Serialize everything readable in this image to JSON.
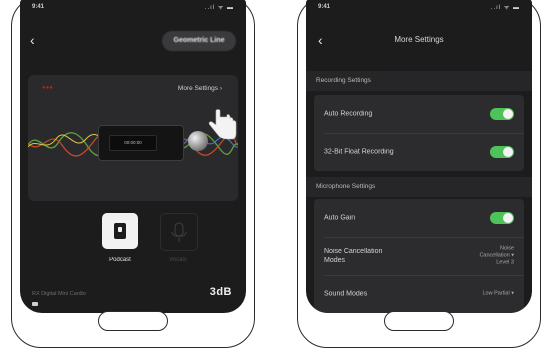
{
  "left_screen": {
    "status": {
      "time": "9:41",
      "icons": "..ıl ᯤ ▬"
    },
    "header": {
      "back_icon": "chevron-left-icon",
      "geometric_button_label": "Geometric Line"
    },
    "card": {
      "more_settings_label": "More Settings  ›",
      "device_screen_text": "00:00:00",
      "wave_colors": [
        "#5c9e3c",
        "#c94a2a",
        "#e0c24a",
        "#4a7ec9"
      ]
    },
    "modes": [
      {
        "label": "Podcast",
        "icon": "podcast-device-icon",
        "selected": true
      },
      {
        "label": "Vocals",
        "icon": "vocal-mic-icon",
        "selected": false
      }
    ],
    "footer": {
      "text": "RX Digital Mini Cardio",
      "logo": "3dB"
    }
  },
  "right_screen": {
    "status": {
      "time": "9:41",
      "icons": "..ıl ᯤ ▬"
    },
    "header": {
      "back_icon": "chevron-left-icon",
      "title": "More Settings"
    },
    "sections": [
      {
        "title": "Recording Settings",
        "rows": [
          {
            "label": "Auto Recording",
            "type": "toggle",
            "on": true
          },
          {
            "label": "32-Bit Float Recording",
            "type": "toggle",
            "on": true
          }
        ]
      },
      {
        "title": "Microphone Settings",
        "rows": [
          {
            "label": "Auto Gain",
            "type": "toggle",
            "on": true
          },
          {
            "label": "Noise Cancellation\nModes",
            "type": "value",
            "value": "Noise\nCancellation ▾\nLevel 3"
          },
          {
            "label": "Sound Modes",
            "type": "value",
            "value": "Low Partial ▾"
          }
        ]
      }
    ],
    "accent_color": "#4fc25a"
  }
}
